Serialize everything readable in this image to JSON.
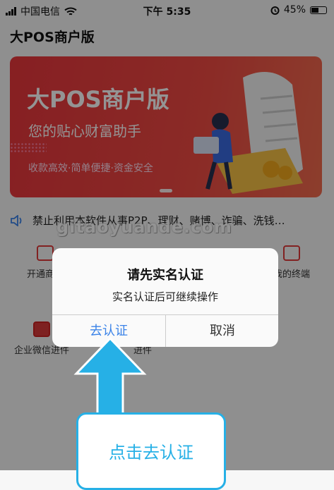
{
  "status_bar": {
    "carrier": "中国电信",
    "time": "下午 5:35",
    "battery": "45%",
    "battery_level": 0.45
  },
  "app": {
    "title": "大POS商户版"
  },
  "banner": {
    "title": "大POS商户版",
    "subtitle": "您的贴心财富助手",
    "tagline": "收款高效·简单便捷·资金安全"
  },
  "notice": {
    "text": "禁止利用本软件从事P2P、理财、赌博、诈骗、洗钱…"
  },
  "watermark": {
    "text": "gitaoyuande.com"
  },
  "menu": [
    {
      "label": "开通商户"
    },
    {
      "label": "我的终端"
    },
    {
      "label": "企业微信进件"
    },
    {
      "label": "进件"
    }
  ],
  "dialog": {
    "title": "请先实名认证",
    "message": "实名认证后可继续操作",
    "confirm_label": "去认证",
    "cancel_label": "取消"
  },
  "annotation": {
    "label": "点击去认证"
  },
  "colors": {
    "accent": "#3b83e8",
    "banner_red": "#e8363c",
    "callout_blue": "#26b0e6"
  }
}
